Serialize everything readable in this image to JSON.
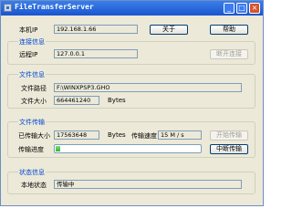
{
  "window": {
    "title": "FileTransferServer"
  },
  "local": {
    "ip_label": "本机IP",
    "ip_value": "192.168.1.66",
    "about_button": "关于",
    "help_button": "帮助"
  },
  "connection": {
    "group_title": "连接信息",
    "remote_ip_label": "远程IP",
    "remote_ip_value": "127.0.0.1",
    "disconnect_button": "断开连接"
  },
  "file_info": {
    "group_title": "文件信息",
    "path_label": "文件路径",
    "path_value": "F:\\WINXPSP3.GHO",
    "size_label": "文件大小",
    "size_value": "664461240",
    "size_unit": "Bytes"
  },
  "transfer": {
    "group_title": "文件传输",
    "transferred_label": "已传输大小",
    "transferred_value": "17563648",
    "transferred_unit": "Bytes",
    "speed_label": "传输速度",
    "speed_value": "15 M / s",
    "start_button": "开始传输",
    "progress_label": "传输进度",
    "progress_fraction": 0.03,
    "stop_button": "中断传输"
  },
  "status": {
    "group_title": "状态信息",
    "local_status_label": "本地状态",
    "local_status_value": "传输中"
  }
}
